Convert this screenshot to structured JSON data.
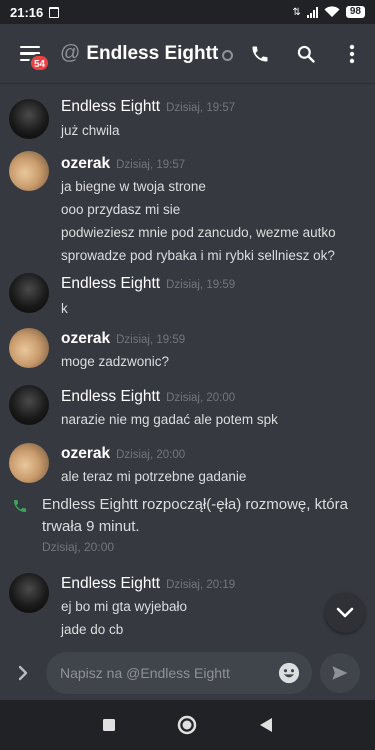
{
  "status_bar": {
    "time": "21:16",
    "battery": "98"
  },
  "header": {
    "badge_count": "54",
    "at_symbol": "@",
    "title": "Endless Eightt"
  },
  "messages": [
    {
      "author": "Endless Eightt",
      "timestamp": "Dzisiaj, 19:57",
      "avatar": "dark-figure-avatar",
      "lines": [
        "już chwila"
      ]
    },
    {
      "author": "ozerak",
      "timestamp": "Dzisiaj, 19:57",
      "avatar": "face-avatar",
      "lines": [
        "ja biegne w twoja strone",
        "ooo przydasz mi sie",
        "podwieziesz mnie pod zancudo, wezme autko",
        "sprowadze pod rybaka i mi rybki sellniesz ok?"
      ]
    },
    {
      "author": "Endless Eightt",
      "timestamp": "Dzisiaj, 19:59",
      "avatar": "dark-figure-avatar",
      "lines": [
        "k"
      ]
    },
    {
      "author": "ozerak",
      "timestamp": "Dzisiaj, 19:59",
      "avatar": "face-avatar",
      "lines": [
        "moge zadzwonic?"
      ]
    },
    {
      "author": "Endless Eightt",
      "timestamp": "Dzisiaj, 20:00",
      "avatar": "dark-figure-avatar",
      "lines": [
        "narazie nie mg gadać ale potem spk"
      ]
    },
    {
      "author": "ozerak",
      "timestamp": "Dzisiaj, 20:00",
      "avatar": "face-avatar",
      "lines": [
        "ale teraz mi potrzebne gadanie"
      ]
    },
    {
      "author": "Endless Eightt",
      "timestamp": "Dzisiaj, 20:19",
      "avatar": "dark-figure-avatar",
      "lines": [
        "ej bo mi gta wyjebało",
        "jade do cb"
      ]
    }
  ],
  "call_notice": {
    "line1": "Endless Eightt rozpoczął(-ęła) rozmowę, która",
    "line2": "trwała 9 minut.",
    "timestamp": "Dzisiaj, 20:00"
  },
  "composer": {
    "placeholder": "Napisz na @Endless Eightt"
  },
  "colors": {
    "background": "#36393f",
    "badge": "#ed4245",
    "call_icon": "#3ba55d",
    "timestamp": "#72767d"
  }
}
